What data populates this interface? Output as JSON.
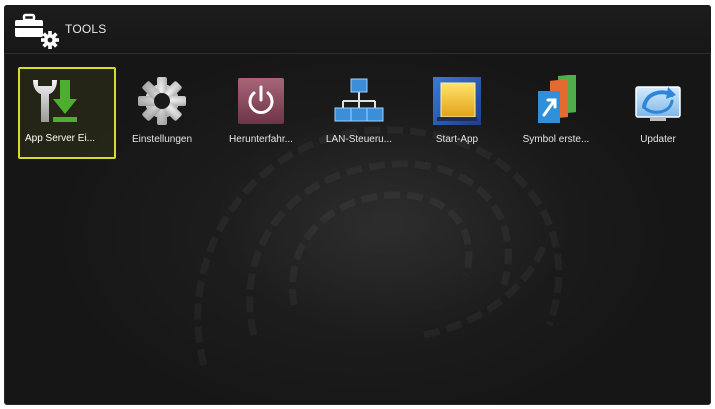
{
  "header": {
    "title": "TOOLS",
    "icon": "toolbox-gear-icon"
  },
  "apps": [
    {
      "label": "App Server Ei...",
      "icon": "wrench-download-icon",
      "selected": true
    },
    {
      "label": "Einstellungen",
      "icon": "gear-icon",
      "selected": false
    },
    {
      "label": "Herunterfahr...",
      "icon": "power-icon",
      "selected": false
    },
    {
      "label": "LAN-Steueru...",
      "icon": "network-icon",
      "selected": false
    },
    {
      "label": "Start-App",
      "icon": "start-app-icon",
      "selected": false
    },
    {
      "label": "Symbol erste...",
      "icon": "shortcut-icon",
      "selected": false
    },
    {
      "label": "Updater",
      "icon": "updater-icon",
      "selected": false
    }
  ],
  "colors": {
    "selection": "#d7dc2c",
    "background": "#1a1a1a"
  }
}
